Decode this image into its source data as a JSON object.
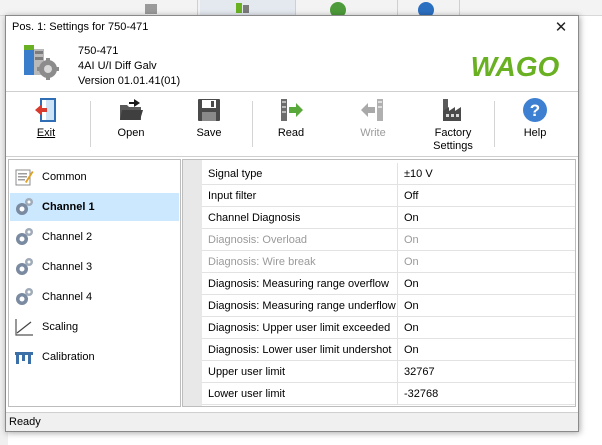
{
  "window": {
    "title": "Pos. 1: Settings for 750-471",
    "close_glyph": "✕"
  },
  "device": {
    "order_number": "750-471",
    "description": "4AI U/I Diff Galv",
    "version": "Version 01.01.41(01)",
    "logo_text": "WAGO",
    "brand_color": "#6ab023"
  },
  "toolbar": {
    "items": [
      {
        "label": "Exit",
        "icon": "exit-door-icon",
        "enabled": true
      },
      {
        "label": "Open",
        "icon": "open-folder-icon",
        "enabled": true
      },
      {
        "label": "Save",
        "icon": "floppy-disk-icon",
        "enabled": true
      },
      {
        "label": "Read",
        "icon": "read-from-device-icon",
        "enabled": true
      },
      {
        "label": "Write",
        "icon": "write-to-device-icon",
        "enabled": false
      },
      {
        "label": "Factory Settings",
        "icon": "factory-icon",
        "enabled": true
      },
      {
        "label": "Help",
        "icon": "help-icon",
        "enabled": true
      }
    ]
  },
  "nav": {
    "items": [
      {
        "label": "Common",
        "icon": "notepad-icon",
        "selected": false
      },
      {
        "label": "Channel 1",
        "icon": "gears-icon",
        "selected": true
      },
      {
        "label": "Channel 2",
        "icon": "gears-icon",
        "selected": false
      },
      {
        "label": "Channel 3",
        "icon": "gears-icon",
        "selected": false
      },
      {
        "label": "Channel 4",
        "icon": "gears-icon",
        "selected": false
      },
      {
        "label": "Scaling",
        "icon": "line-graph-icon",
        "selected": false
      },
      {
        "label": "Calibration",
        "icon": "calipers-icon",
        "selected": false
      }
    ],
    "selected_color": "#cce8ff"
  },
  "properties": {
    "rows": [
      {
        "name": "Signal type",
        "value": "±10 V",
        "enabled": true
      },
      {
        "name": "Input filter",
        "value": "Off",
        "enabled": true
      },
      {
        "name": "Channel Diagnosis",
        "value": "On",
        "enabled": true
      },
      {
        "name": "Diagnosis: Overload",
        "value": "On",
        "enabled": false
      },
      {
        "name": "Diagnosis: Wire break",
        "value": "On",
        "enabled": false
      },
      {
        "name": "Diagnosis: Measuring range overflow",
        "value": "On",
        "enabled": true
      },
      {
        "name": "Diagnosis: Measuring range underflow",
        "value": "On",
        "enabled": true
      },
      {
        "name": "Diagnosis: Upper user limit exceeded",
        "value": "On",
        "enabled": true
      },
      {
        "name": "Diagnosis: Lower user limit undershot",
        "value": "On",
        "enabled": true
      },
      {
        "name": "Upper user limit",
        "value": "32767",
        "enabled": true
      },
      {
        "name": "Lower user limit",
        "value": "-32768",
        "enabled": true
      }
    ]
  },
  "status": {
    "text": "Ready"
  }
}
